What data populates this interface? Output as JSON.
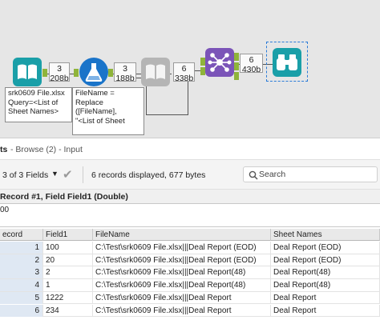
{
  "workflow": {
    "input_tool": {
      "icon": "book-icon",
      "color": "#1a9fa8"
    },
    "formula_tool": {
      "icon": "flask-icon",
      "color": "#1a74c9"
    },
    "output_tool": {
      "icon": "book-icon",
      "color": "#b5b5b5"
    },
    "join_tool": {
      "icon": "network-icon",
      "color": "#7b54b8"
    },
    "browse_tool": {
      "icon": "binoculars-icon",
      "color": "#1a9fa8"
    },
    "chips": [
      {
        "count": "3",
        "size": "208b"
      },
      {
        "count": "3",
        "size": "188b"
      },
      {
        "count": "6",
        "size": "338b"
      },
      {
        "count": "6",
        "size": "430b"
      }
    ],
    "annotations": {
      "input": "srk0609 File.xlsx\nQuery=<List of\nSheet Names>",
      "formula": "FileName =\nReplace\n([FileName],\n\"<List of Sheet"
    }
  },
  "panel": {
    "title_part": "ts",
    "browse_label": "- Browse (2) - Input"
  },
  "toolbar": {
    "fields_label": "3 of 3 Fields",
    "records_info": "6 records displayed, 677 bytes",
    "search_placeholder": "Search"
  },
  "record_header": "Record #1, Field Field1 (Double)",
  "record_value": "00",
  "grid": {
    "columns": [
      "ecord",
      "Field1",
      "FileName",
      "Sheet Names"
    ],
    "rows": [
      [
        "1",
        "100",
        "C:\\Test\\srk0609 File.xlsx|||Deal Report (EOD)",
        "Deal Report (EOD)"
      ],
      [
        "2",
        "20",
        "C:\\Test\\srk0609 File.xlsx|||Deal Report (EOD)",
        "Deal Report (EOD)"
      ],
      [
        "3",
        "2",
        "C:\\Test\\srk0609 File.xlsx|||Deal Report(48)",
        "Deal Report(48)"
      ],
      [
        "4",
        "1",
        "C:\\Test\\srk0609 File.xlsx|||Deal Report(48)",
        "Deal Report(48)"
      ],
      [
        "5",
        "1222",
        "C:\\Test\\srk0609 File.xlsx|||Deal Report",
        "Deal Report"
      ],
      [
        "6",
        "234",
        "C:\\Test\\srk0609 File.xlsx|||Deal Report",
        "Deal Report"
      ]
    ]
  },
  "colors": {
    "connection_port": "#8fb43a",
    "selection_outline": "#2a7bd8",
    "record_number_bg": "#dfe8f3"
  }
}
